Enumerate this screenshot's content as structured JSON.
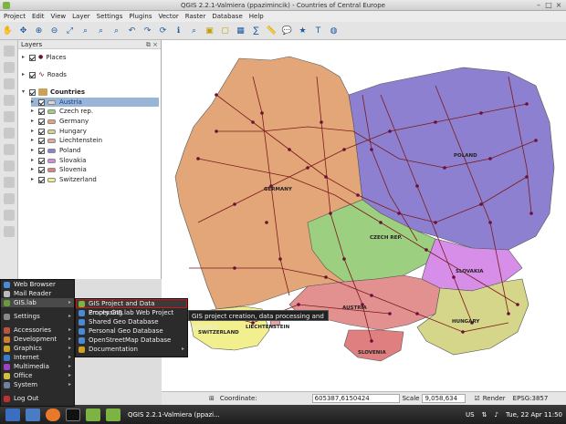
{
  "window": {
    "title": "QGIS 2.2.1-Valmiera (ppazimincik) - Countries of Central Europe"
  },
  "menubar": [
    "Project",
    "Edit",
    "View",
    "Layer",
    "Settings",
    "Plugins",
    "Vector",
    "Raster",
    "Database",
    "Help"
  ],
  "layers_panel": {
    "title": "Layers",
    "items": [
      {
        "name": "Places",
        "level": 0
      },
      {
        "name": "Roads",
        "level": 0
      },
      {
        "name": "Countries",
        "level": 0
      },
      {
        "name": "Austria",
        "level": 1,
        "selected": true,
        "color": "#d9d9d9"
      },
      {
        "name": "Czech rep.",
        "level": 1,
        "color": "#9ccf7f"
      },
      {
        "name": "Germany",
        "level": 1,
        "color": "#e3a679"
      },
      {
        "name": "Hungary",
        "level": 1,
        "color": "#cfd690"
      },
      {
        "name": "Liechtenstein",
        "level": 1,
        "color": "#e3a6a6"
      },
      {
        "name": "Poland",
        "level": 1,
        "color": "#8e80d0"
      },
      {
        "name": "Slovakia",
        "level": 1,
        "color": "#d08ee0"
      },
      {
        "name": "Slovenia",
        "level": 1,
        "color": "#e08080"
      },
      {
        "name": "Switzerland",
        "level": 1,
        "color": "#f0ee90"
      }
    ]
  },
  "map_labels": {
    "germany": "GERMANY",
    "poland": "POLAND",
    "czech": "CZECH REP.",
    "slovakia": "SLOVAKIA",
    "austria": "AUSTRIA",
    "hungary": "HUNGARY",
    "switzerland": "SWITZERLAND",
    "liechtenstein": "LIECHTENSTEIN",
    "slovenia": "SLOVENIA"
  },
  "colors": {
    "germany": "#e3a679",
    "poland": "#8e80d0",
    "czech": "#9ccf7f",
    "slovakia": "#d68ee8",
    "austria": "#e39090",
    "hungary": "#d6d68a",
    "switzerland": "#f2ef8f",
    "slovenia": "#e07f7f",
    "roads": "#7a1a1a",
    "places": "#6a0f3a"
  },
  "statusbar": {
    "coord_label": "Coordinate:",
    "coord_value": "605387,6150424",
    "scale_label": "Scale",
    "scale_value": "9,058,634",
    "render_label": "Render",
    "crs": "EPSG:3857"
  },
  "start_menu": {
    "items": [
      {
        "label": "Web Browser",
        "icon": "globe-icon",
        "color": "#4a8ad4"
      },
      {
        "label": "Mail Reader",
        "icon": "mail-icon",
        "color": "#bbbbbb"
      },
      {
        "label": "GIS.lab",
        "icon": "gislab-icon",
        "color": "#6a9a3a",
        "submenu": true
      },
      {
        "label": "Settings",
        "icon": "settings-icon",
        "color": "#888888",
        "submenu": true
      },
      {
        "label": "Accessories",
        "icon": "accessories-icon",
        "color": "#c05040",
        "submenu": true
      },
      {
        "label": "Development",
        "icon": "development-icon",
        "color": "#d08030",
        "submenu": true
      },
      {
        "label": "Graphics",
        "icon": "graphics-icon",
        "color": "#d0a020",
        "submenu": true
      },
      {
        "label": "Internet",
        "icon": "internet-icon",
        "color": "#3a7ad0",
        "submenu": true
      },
      {
        "label": "Multimedia",
        "icon": "multimedia-icon",
        "color": "#a040c0",
        "submenu": true
      },
      {
        "label": "Office",
        "icon": "office-icon",
        "color": "#d0c040",
        "submenu": true
      },
      {
        "label": "System",
        "icon": "system-icon",
        "color": "#7080a0",
        "submenu": true
      },
      {
        "label": "Log Out",
        "icon": "logout-icon",
        "color": "#c03030"
      }
    ],
    "gislab_submenu": [
      {
        "label": "GIS Project and Data Processing",
        "icon": "qgis-icon",
        "color": "#7cb342"
      },
      {
        "label": "Empty GIS.lab Web Project",
        "icon": "web-icon",
        "color": "#4a8ad4"
      },
      {
        "label": "Shared Geo Database",
        "icon": "db-icon",
        "color": "#4a8ad4"
      },
      {
        "label": "Personal Geo Database",
        "icon": "db-icon",
        "color": "#4a8ad4"
      },
      {
        "label": "OpenStreetMap Database",
        "icon": "db-icon",
        "color": "#4a8ad4"
      },
      {
        "label": "Documentation",
        "icon": "docs-icon",
        "color": "#d0a020",
        "submenu": true
      }
    ],
    "tooltip": "GIS project creation, data processing and analysis"
  },
  "taskbar": {
    "task_label": "QGIS 2.2.1-Valmiera (ppazi...",
    "layout": "US",
    "clock": "Tue, 22 Apr  11:50"
  }
}
